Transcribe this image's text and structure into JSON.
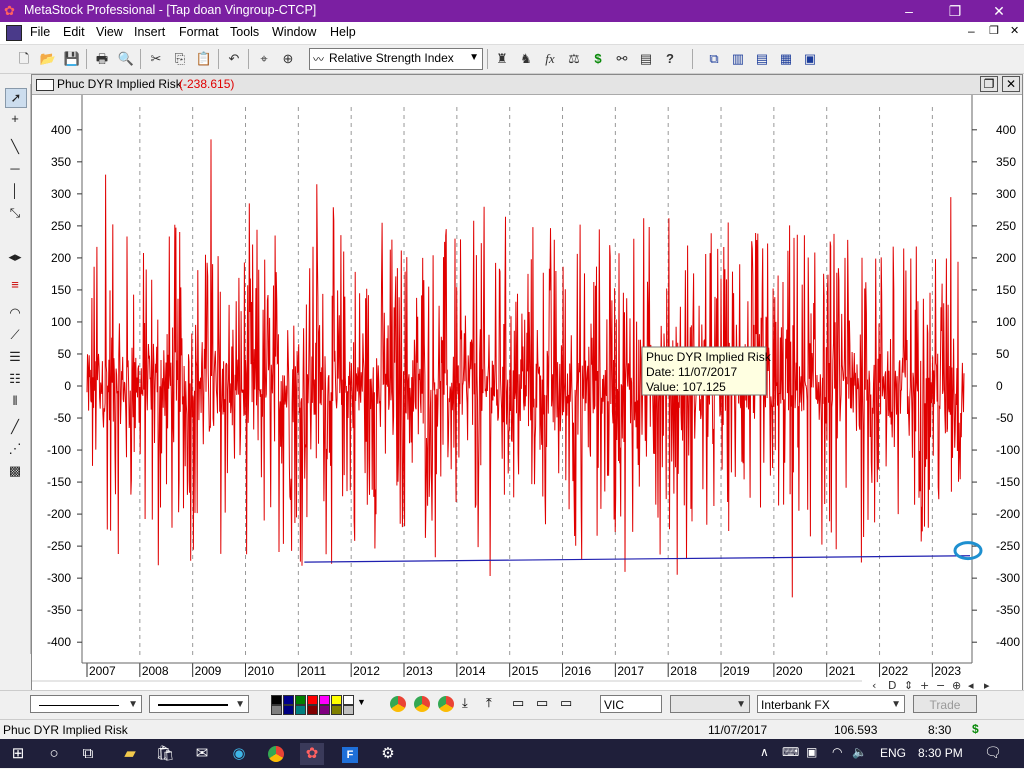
{
  "window": {
    "title": "MetaStock Professional - [Tap doan Vingroup-CTCP]",
    "min_glyph": "–",
    "max_glyph": "❐",
    "close_glyph": "✕"
  },
  "menu": [
    "File",
    "Edit",
    "View",
    "Insert",
    "Format",
    "Tools",
    "Window",
    "Help"
  ],
  "toolbar": {
    "indicator_select": "Relative Strength Index"
  },
  "chart_window": {
    "title": "Phuc DYR Implied Risk",
    "title_value": "(-238.615)"
  },
  "tooltip": {
    "line1": "Phuc DYR Implied Risk",
    "line2": "Date: 11/07/2017",
    "line3": "Value: 107.125"
  },
  "chart_data": {
    "type": "line",
    "title": "Phuc DYR Implied Risk",
    "ylim": [
      -420,
      420
    ],
    "y_ticks": [
      400,
      350,
      300,
      250,
      200,
      150,
      100,
      50,
      0,
      -50,
      -100,
      -150,
      -200,
      -250,
      -300,
      -350,
      -400
    ],
    "x_ticks": [
      "2007",
      "2008",
      "2009",
      "2010",
      "2011",
      "2012",
      "2013",
      "2014",
      "2015",
      "2016",
      "2017",
      "2018",
      "2019",
      "2020",
      "2021",
      "2022",
      "2023"
    ],
    "grid": "vertical dashed at year boundaries",
    "series": [
      {
        "color": "#e00000",
        "x": [
          "2007",
          "2008",
          "2009",
          "2010",
          "2011",
          "2012",
          "2013",
          "2014",
          "2015",
          "2016",
          "2017",
          "2018",
          "2019",
          "2020",
          "2021",
          "2022",
          "2023"
        ],
        "values": [
          330,
          -280,
          385,
          -210,
          315,
          -170,
          200,
          -190,
          175,
          -190,
          230,
          -270,
          190,
          -330,
          200,
          -200,
          295
        ],
        "style": "noisy oscillation roughly between -350 and 385"
      },
      {
        "color": "#1f1fb0",
        "x": [
          "2011",
          "2023"
        ],
        "values": [
          -275,
          -265
        ],
        "style": "flat line"
      }
    ]
  },
  "bottom": {
    "symbol": "VIC",
    "feed": "Interbank FX",
    "trade": "Trade"
  },
  "status": {
    "left": "Phuc DYR Implied Risk",
    "date": "11/07/2017",
    "value": "106.593",
    "time": "8:30",
    "dollar": "$"
  },
  "taskbar": {
    "lang": "ENG",
    "clock": "8:30 PM"
  },
  "colors": {
    "titlebar": "#7b1fa2",
    "series": "#e00000",
    "line2": "#1f1fb0",
    "highlight": "#1e90d0"
  }
}
